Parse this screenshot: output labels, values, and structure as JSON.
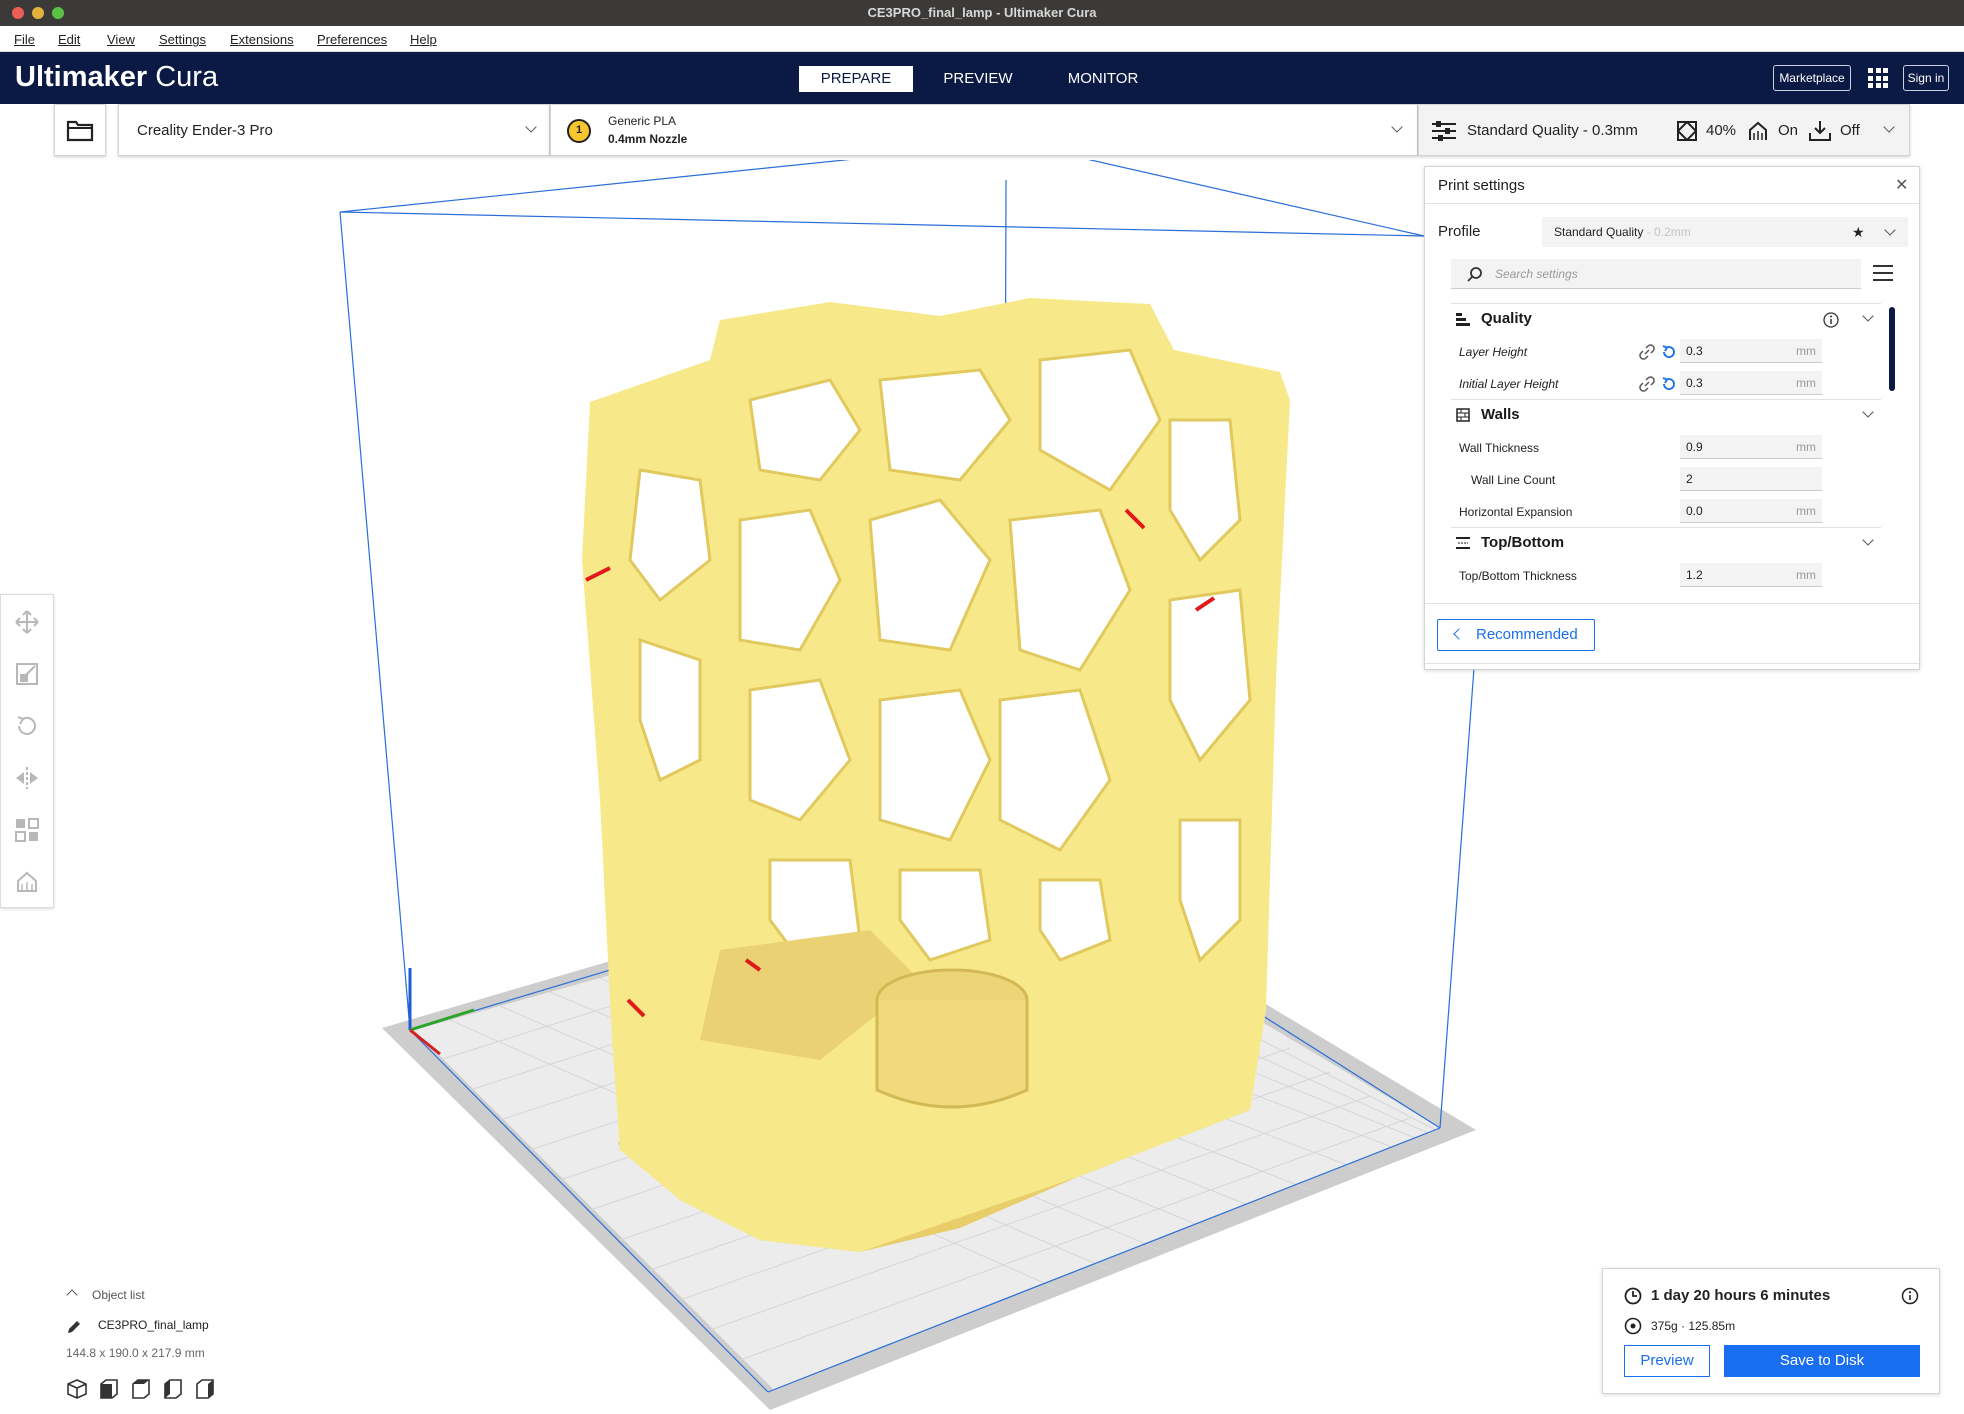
{
  "window": {
    "title": "CE3PRO_final_lamp - Ultimaker Cura"
  },
  "menu": [
    "File",
    "Edit",
    "View",
    "Settings",
    "Extensions",
    "Preferences",
    "Help"
  ],
  "brand": {
    "bold": "Ultimaker",
    "light": " Cura"
  },
  "stages": [
    "PREPARE",
    "PREVIEW",
    "MONITOR"
  ],
  "header": {
    "marketplace": "Marketplace",
    "signin": "Sign in"
  },
  "printer": {
    "name": "Creality Ender-3 Pro"
  },
  "material": {
    "badge": "1",
    "name": "Generic PLA",
    "nozzle": "0.4mm Nozzle"
  },
  "quick": {
    "profile": "Standard Quality - 0.3mm",
    "infill": "40%",
    "support": "On",
    "adhesion": "Off"
  },
  "print_settings": {
    "title": "Print settings",
    "profile_label": "Profile",
    "profile_value": "Standard Quality",
    "profile_suffix": " - 0.2mm",
    "search_placeholder": "Search settings",
    "categories": {
      "quality": "Quality",
      "walls": "Walls",
      "topbottom": "Top/Bottom"
    },
    "settings": [
      {
        "label": "Layer Height",
        "value": "0.3",
        "unit": "mm"
      },
      {
        "label": "Initial Layer Height",
        "value": "0.3",
        "unit": "mm"
      },
      {
        "label": "Wall Thickness",
        "value": "0.9",
        "unit": "mm"
      },
      {
        "label": "Wall Line Count",
        "value": "2",
        "unit": ""
      },
      {
        "label": "Horizontal Expansion",
        "value": "0.0",
        "unit": "mm"
      },
      {
        "label": "Top/Bottom Thickness",
        "value": "1.2",
        "unit": "mm"
      }
    ],
    "recommended_button": "Recommended"
  },
  "object_list": {
    "header": "Object list",
    "object_name": "CE3PRO_final_lamp",
    "dimensions": "144.8 x 190.0 x 217.9 mm"
  },
  "action": {
    "print_time": "1 day 20 hours 6 minutes",
    "material_usage": "375g · 125.85m",
    "preview_button": "Preview",
    "save_button": "Save to Disk"
  },
  "colors": {
    "header_bg": "#0b1a45",
    "accent": "#196ef0",
    "model": "#f7e98a"
  }
}
